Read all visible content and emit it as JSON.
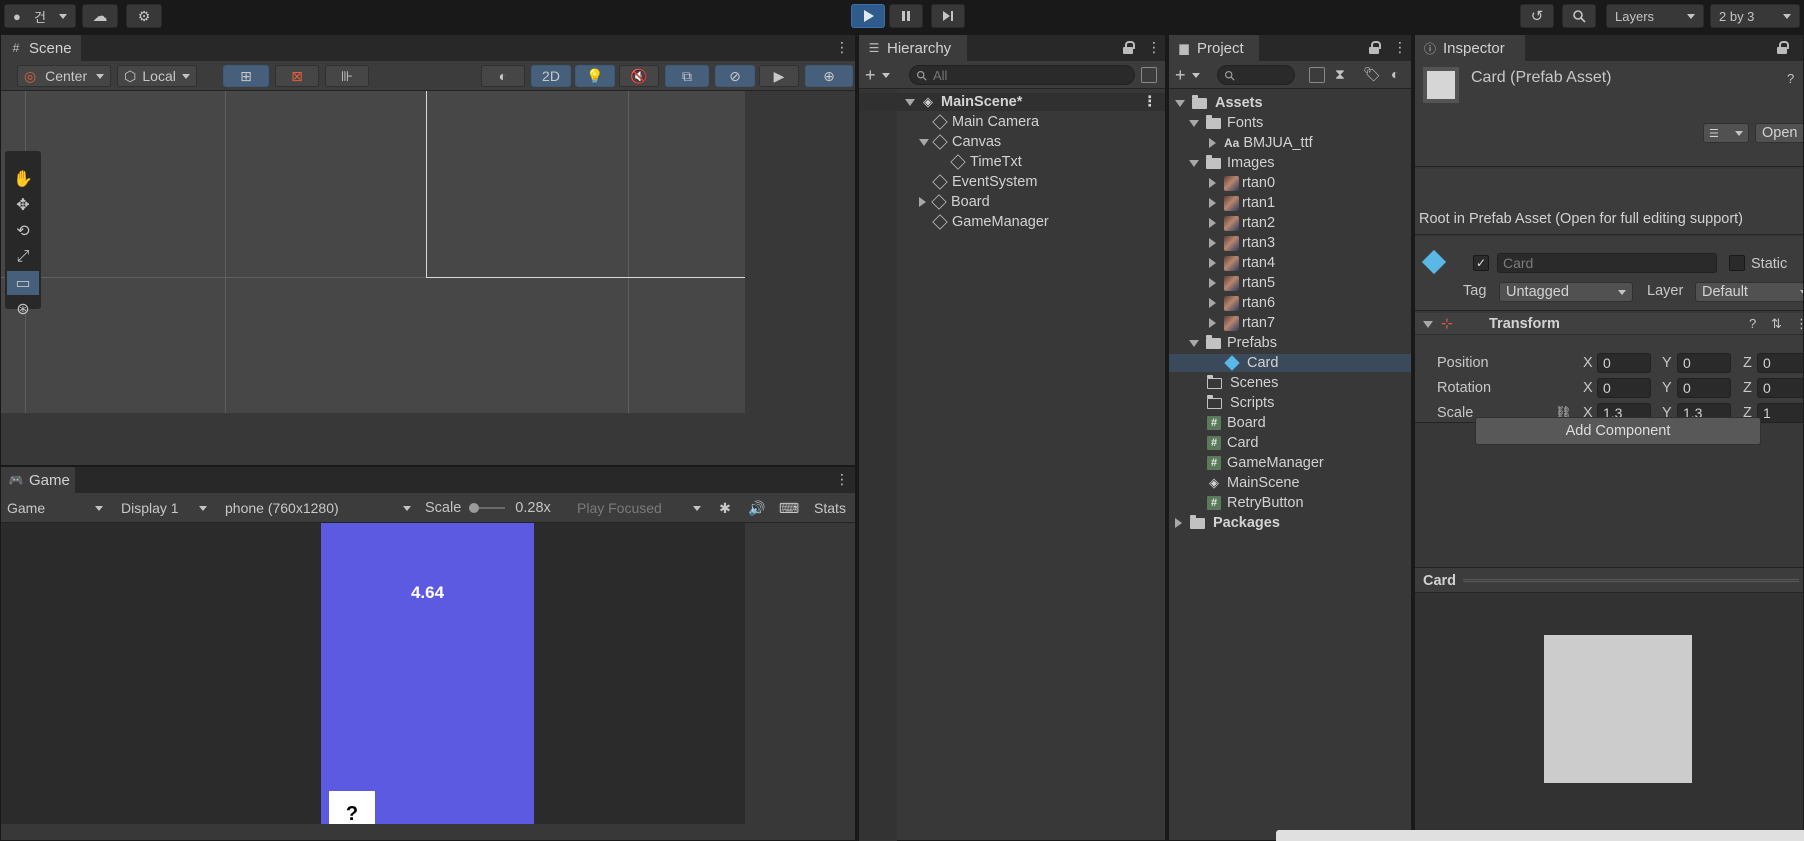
{
  "toolbar": {
    "account_label": "건",
    "layers_label": "Layers",
    "layout_label": "2 by 3"
  },
  "scene": {
    "tab_label": "Scene",
    "pivot_label": "Center",
    "space_label": "Local",
    "mode_2d_label": "2D"
  },
  "game": {
    "tab_label": "Game",
    "view_select": "Game",
    "display_select": "Display 1",
    "resolution_select": "phone (760x1280)",
    "scale_label": "Scale",
    "scale_value": "0.28x",
    "play_mode_select": "Play Focused",
    "stats_label": "Stats",
    "timer_text": "4.64",
    "card_text": "?",
    "colors": {
      "background": "#5c5ae0",
      "card": "#ffffff"
    }
  },
  "hierarchy": {
    "tab_label": "Hierarchy",
    "search_placeholder": "All",
    "scene_name": "MainScene*",
    "items": [
      {
        "label": "Main Camera"
      },
      {
        "label": "Canvas"
      },
      {
        "label": "TimeTxt"
      },
      {
        "label": "EventSystem"
      },
      {
        "label": "Board"
      },
      {
        "label": "GameManager"
      }
    ]
  },
  "project": {
    "tab_label": "Project",
    "items": [
      {
        "label": "Assets"
      },
      {
        "label": "Fonts"
      },
      {
        "label": "BMJUA_ttf"
      },
      {
        "label": "Images"
      },
      {
        "label": "rtan0"
      },
      {
        "label": "rtan1"
      },
      {
        "label": "rtan2"
      },
      {
        "label": "rtan3"
      },
      {
        "label": "rtan4"
      },
      {
        "label": "rtan5"
      },
      {
        "label": "rtan6"
      },
      {
        "label": "rtan7"
      },
      {
        "label": "Prefabs"
      },
      {
        "label": "Card"
      },
      {
        "label": "Scenes"
      },
      {
        "label": "Scripts"
      },
      {
        "label": "Board"
      },
      {
        "label": "Card"
      },
      {
        "label": "GameManager"
      },
      {
        "label": "MainScene"
      },
      {
        "label": "RetryButton"
      },
      {
        "label": "Packages"
      }
    ]
  },
  "inspector": {
    "tab_label": "Inspector",
    "asset_title": "Card (Prefab Asset)",
    "open_label": "Open",
    "root_notice": "Root in Prefab Asset (Open for full editing support)",
    "object_name": "Card",
    "static_label": "Static",
    "tag_label": "Tag",
    "tag_value": "Untagged",
    "layer_label": "Layer",
    "layer_value": "Default",
    "transform_label": "Transform",
    "position_label": "Position",
    "rotation_label": "Rotation",
    "scale_label": "Scale",
    "axis_x": "X",
    "axis_y": "Y",
    "axis_z": "Z",
    "position": {
      "x": "0",
      "y": "0",
      "z": "0"
    },
    "rotation": {
      "x": "0",
      "y": "0",
      "z": "0"
    },
    "scale": {
      "x": "1.3",
      "y": "1.3",
      "z": "1"
    },
    "add_component_label": "Add Component",
    "preview_title": "Card",
    "preview_color": "#cccccc"
  }
}
